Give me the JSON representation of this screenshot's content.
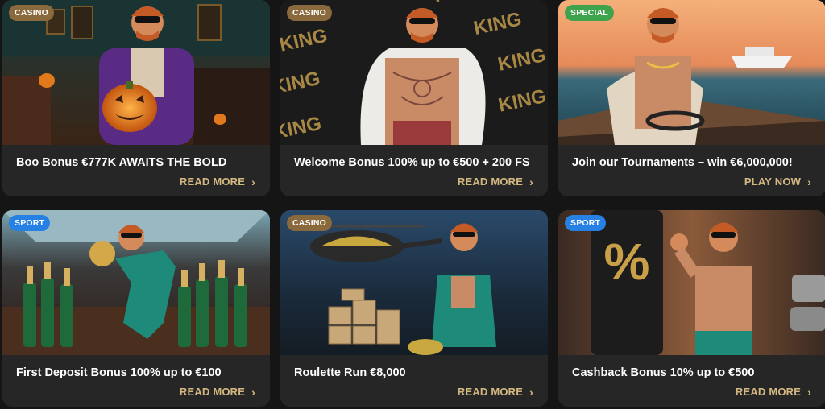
{
  "colors": {
    "casino_badge": "#8a6a3c",
    "special_badge": "#3fa34d",
    "sport_badge": "#2780e3",
    "cta": "#d4b882",
    "card_bg": "#262626"
  },
  "cards": [
    {
      "badge": "CASINO",
      "badge_type": "casino",
      "title": "Boo Bonus €777K AWAITS THE BOLD",
      "cta": "READ MORE",
      "icon": "chevron-right-icon"
    },
    {
      "badge": "CASINO",
      "badge_type": "casino",
      "title": "Welcome Bonus 100% up to €500 + 200 FS",
      "cta": "READ MORE",
      "icon": "chevron-right-icon",
      "art_text": "KING"
    },
    {
      "badge": "SPECIAL",
      "badge_type": "special",
      "title": "Join our Tournaments – win €6,000,000!",
      "cta": "PLAY NOW",
      "icon": "chevron-right-icon"
    },
    {
      "badge": "SPORT",
      "badge_type": "sport",
      "title": "First Deposit Bonus 100% up to €100",
      "cta": "READ MORE",
      "icon": "chevron-right-icon"
    },
    {
      "badge": "CASINO",
      "badge_type": "casino",
      "title": "Roulette Run €8,000",
      "cta": "READ MORE",
      "icon": "chevron-right-icon"
    },
    {
      "badge": "SPORT",
      "badge_type": "sport",
      "title": "Cashback Bonus 10% up to €500",
      "cta": "READ MORE",
      "icon": "chevron-right-icon",
      "art_text": "%"
    }
  ]
}
